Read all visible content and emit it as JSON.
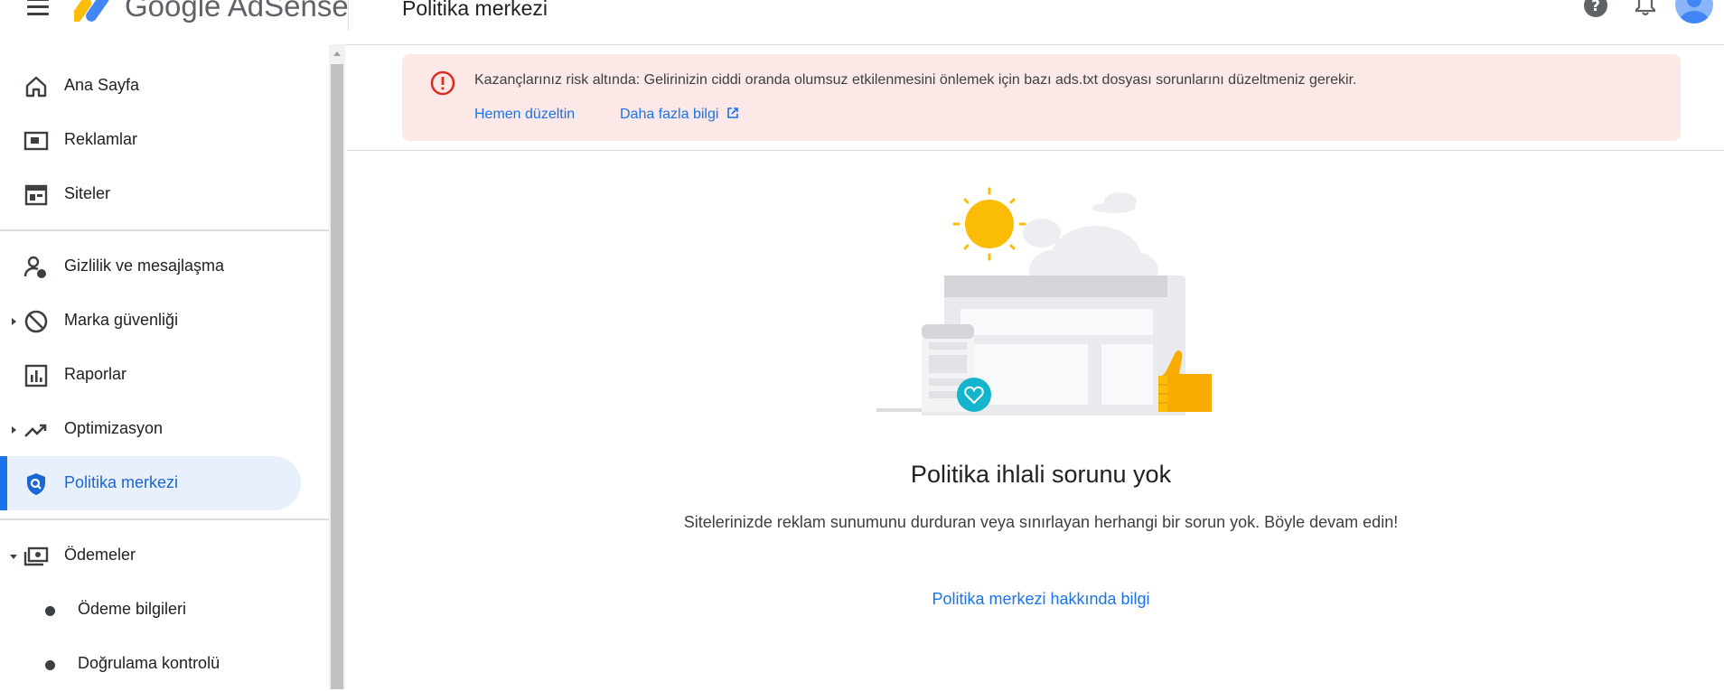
{
  "header": {
    "brand": "Google AdSense",
    "page_title": "Politika merkezi",
    "icons": [
      "menu-icon",
      "adsense-logo-icon",
      "help-icon",
      "notifications-icon",
      "account-avatar"
    ]
  },
  "sidebar": {
    "items": [
      {
        "label": "Ana Sayfa",
        "icon": "home-icon"
      },
      {
        "label": "Reklamlar",
        "icon": "ads-icon"
      },
      {
        "label": "Siteler",
        "icon": "sites-icon"
      },
      {
        "label": "Gizlilik ve mesajlaşma",
        "icon": "privacy-icon"
      },
      {
        "label": "Marka güvenliği",
        "icon": "block-icon",
        "expandable": true
      },
      {
        "label": "Raporlar",
        "icon": "reports-icon"
      },
      {
        "label": "Optimizasyon",
        "icon": "trending-icon",
        "expandable": true
      },
      {
        "label": "Politika merkezi",
        "icon": "policy-shield-icon",
        "active": true
      },
      {
        "label": "Ödemeler",
        "icon": "payments-icon",
        "expanded": true
      }
    ],
    "sub_items": [
      {
        "label": "Ödeme bilgileri"
      },
      {
        "label": "Doğrulama kontrolü"
      }
    ]
  },
  "alert": {
    "message": "Kazançlarınız risk altında: Gelirinizin ciddi oranda olumsuz etkilenmesini önlemek için bazı ads.txt dosyası sorunlarını düzeltmeniz gerekir.",
    "fix_link": "Hemen düzeltin",
    "learn_link": "Daha fazla bilgi",
    "icon": "error-icon"
  },
  "empty_state": {
    "title": "Politika ihlali sorunu yok",
    "description": "Sitelerinizde reklam sunumunu durduran veya sınırlayan herhangi bir sorun yok. Böyle devam edin!",
    "link": "Politika merkezi hakkında bilgi"
  },
  "colors": {
    "accent": "#1a73e8",
    "active_bg": "#e8f0fe",
    "alert_bg": "#fce8e6",
    "alert_red": "#d93025",
    "sun": "#fbbc04",
    "heart_badge": "#12b5cb"
  }
}
